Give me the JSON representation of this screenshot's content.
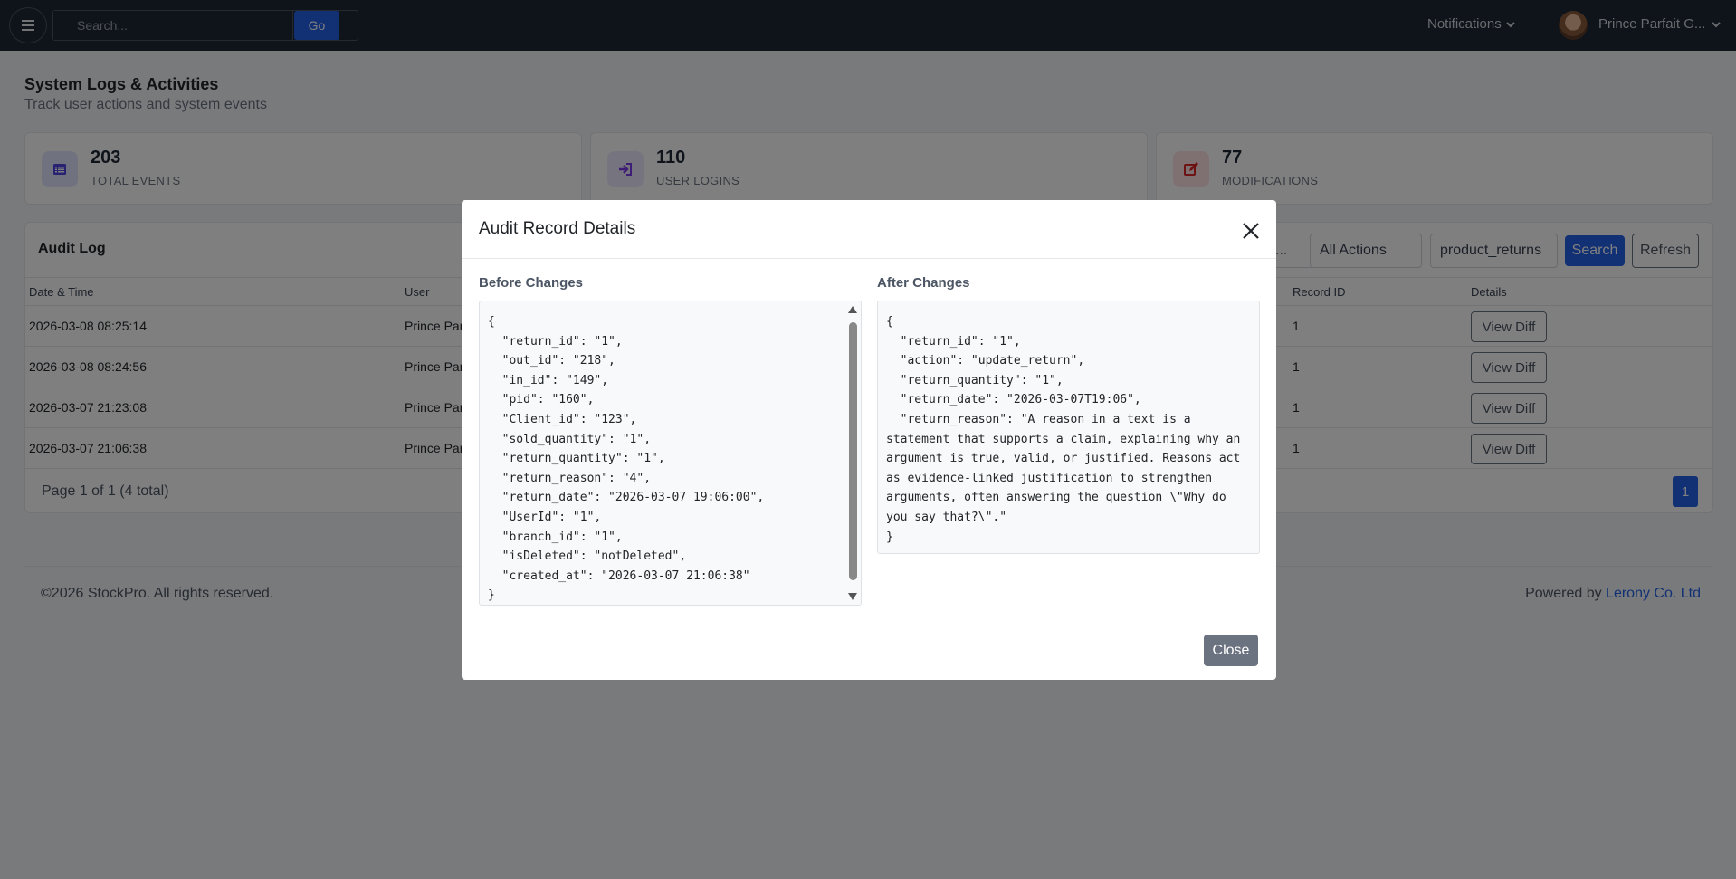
{
  "topbar": {
    "search_placeholder": "Search...",
    "go_label": "Go",
    "notifications_label": "Notifications",
    "user_name": "Prince Parfait G..."
  },
  "page": {
    "title": "System Logs & Activities",
    "subtitle": "Track user actions and system events"
  },
  "stats": [
    {
      "value": "203",
      "label": "TOTAL EVENTS",
      "icon": "list-icon",
      "color": "#4f46e5",
      "bg": "#e0e7ff"
    },
    {
      "value": "110",
      "label": "USER LOGINS",
      "icon": "sign-in-icon",
      "color": "#7c3aed",
      "bg": "#ede9fe"
    },
    {
      "value": "77",
      "label": "MODIFICATIONS",
      "icon": "edit-icon",
      "color": "#dc2626",
      "bg": "#fee2e2"
    }
  ],
  "audit_log": {
    "title": "Audit Log",
    "filter_placeholder_visible": "...",
    "action_filter": "All Actions",
    "table_filter": "product_returns",
    "search_label": "Search",
    "refresh_label": "Refresh",
    "columns": [
      "Date & Time",
      "User",
      "Record ID",
      "Details"
    ],
    "rows": [
      {
        "datetime": "2026-03-08 08:25:14",
        "user": "Prince Par",
        "record_id": "1",
        "action": "View Diff"
      },
      {
        "datetime": "2026-03-08 08:24:56",
        "user": "Prince Par",
        "record_id": "1",
        "action": "View Diff"
      },
      {
        "datetime": "2026-03-07 21:23:08",
        "user": "Prince Par",
        "record_id": "1",
        "action": "View Diff"
      },
      {
        "datetime": "2026-03-07 21:06:38",
        "user": "Prince Par",
        "record_id": "1",
        "action": "View Diff"
      }
    ],
    "pager_text": "Page 1 of 1 (4 total)",
    "current_page": "1"
  },
  "footer": {
    "copyright": "©2026 StockPro. All rights reserved.",
    "powered_by": "Powered by ",
    "company": "Lerony Co. Ltd"
  },
  "modal": {
    "title": "Audit Record Details",
    "before_title": "Before Changes",
    "after_title": "After Changes",
    "before_json": "{\n  \"return_id\": \"1\",\n  \"out_id\": \"218\",\n  \"in_id\": \"149\",\n  \"pid\": \"160\",\n  \"Client_id\": \"123\",\n  \"sold_quantity\": \"1\",\n  \"return_quantity\": \"1\",\n  \"return_reason\": \"4\",\n  \"return_date\": \"2026-03-07 19:06:00\",\n  \"UserId\": \"1\",\n  \"branch_id\": \"1\",\n  \"isDeleted\": \"notDeleted\",\n  \"created_at\": \"2026-03-07 21:06:38\"\n}",
    "after_json": "{\n  \"return_id\": \"1\",\n  \"action\": \"update_return\",\n  \"return_quantity\": \"1\",\n  \"return_date\": \"2026-03-07T19:06\",\n  \"return_reason\": \"A reason in a text is a statement that supports a claim, explaining why an argument is true, valid, or justified. Reasons act as evidence-linked justification to strengthen arguments, often answering the question \\\"Why do you say that?\\\".\"\n}",
    "close_label": "Close"
  }
}
